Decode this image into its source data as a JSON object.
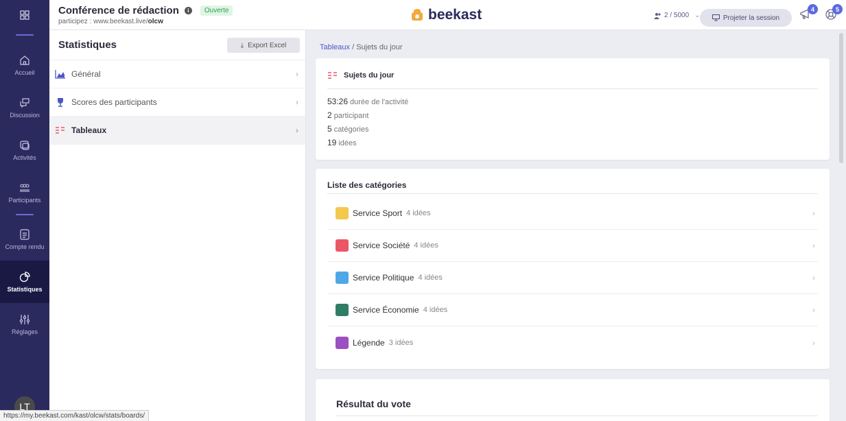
{
  "rail": {
    "items": [
      {
        "label": "Accueil",
        "icon": "home-icon"
      },
      {
        "label": "Discussion",
        "icon": "chat-icon"
      },
      {
        "label": "Activités",
        "icon": "activities-icon"
      },
      {
        "label": "Participants",
        "icon": "participants-icon"
      },
      {
        "label": "Compte rendu",
        "icon": "report-icon"
      },
      {
        "label": "Statistiques",
        "icon": "stats-icon"
      },
      {
        "label": "Réglages",
        "icon": "settings-icon"
      }
    ],
    "avatar": "LT"
  },
  "header": {
    "title": "Conférence de rédaction",
    "status_badge": "Ouverte",
    "sub_prefix": "participez : www.beekast.live/",
    "sub_code": "olcw",
    "logo": "beekast",
    "participants": "2 / 5000",
    "project_button": "Projeter la session",
    "notif1": "4",
    "notif2": "5"
  },
  "left_panel": {
    "title": "Statistiques",
    "export_label": "Export Excel",
    "items": [
      {
        "label": "Général",
        "icon": "chart-icon"
      },
      {
        "label": "Scores des participants",
        "icon": "trophy-icon"
      },
      {
        "label": "Tableaux",
        "icon": "boards-icon"
      }
    ]
  },
  "main": {
    "breadcrumb_link": "Tableaux",
    "breadcrumb_current": " / Sujets du jour",
    "summary": {
      "title": "Sujets du jour",
      "stats": [
        {
          "value": "53:26",
          "label": "durée de l'activité"
        },
        {
          "value": "2",
          "label": "participant"
        },
        {
          "value": "5",
          "label": "catégories"
        },
        {
          "value": "19",
          "label": "idées"
        }
      ]
    },
    "categories": {
      "title": "Liste des catégories",
      "items": [
        {
          "name": "Service Sport",
          "count": "4 idées",
          "color": "#f2c94c"
        },
        {
          "name": "Service Société",
          "count": "4 idées",
          "color": "#eb5766"
        },
        {
          "name": "Service Politique",
          "count": "4 idées",
          "color": "#4ea8e8"
        },
        {
          "name": "Service Économie",
          "count": "4 idées",
          "color": "#2f7d64"
        },
        {
          "name": "Légende",
          "count": "3 idées",
          "color": "#9b4fc0"
        }
      ]
    },
    "vote": {
      "title": "Résultat du vote"
    }
  },
  "status_url": "https://my.beekast.com/kast/olcw/stats/boards/"
}
